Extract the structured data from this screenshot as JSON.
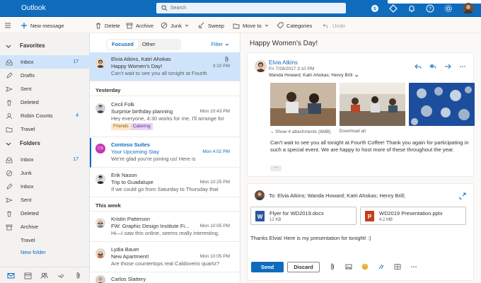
{
  "app": {
    "title": "Outlook"
  },
  "search": {
    "placeholder": "Search"
  },
  "commands": {
    "new_message": "New message",
    "delete": "Delete",
    "archive": "Archive",
    "junk": "Junk",
    "sweep": "Sweep",
    "move_to": "Move to",
    "categories": "Categories",
    "undo": "Undo"
  },
  "sidebar": {
    "favorites_label": "Favorites",
    "favorites": [
      {
        "label": "Inbox",
        "count": "17",
        "icon": "inbox-icon"
      },
      {
        "label": "Drafts",
        "count": "",
        "icon": "pencil-icon"
      },
      {
        "label": "Sent",
        "count": "",
        "icon": "send-icon"
      },
      {
        "label": "Deleted",
        "count": "",
        "icon": "trash-icon"
      },
      {
        "label": "Robin Counts",
        "count": "4",
        "icon": "person-icon"
      },
      {
        "label": "Travel",
        "count": "",
        "icon": "folder-icon"
      }
    ],
    "folders_label": "Folders",
    "folders": [
      {
        "label": "Inbox",
        "count": "17"
      },
      {
        "label": "Junk",
        "count": ""
      },
      {
        "label": "Inbox",
        "count": ""
      },
      {
        "label": "Sent",
        "count": ""
      },
      {
        "label": "Deleted",
        "count": ""
      },
      {
        "label": "Archive",
        "count": ""
      },
      {
        "label": "Travel",
        "count": ""
      }
    ],
    "new_folder": "New folder"
  },
  "list": {
    "pivots": [
      "Focused",
      "Other"
    ],
    "filter": "Filter",
    "sections": {
      "yesterday": "Yesterday",
      "this_week": "This week"
    },
    "messages": [
      {
        "sender": "Elvia Atkins, Katri Ahokas",
        "subject": "Happy Women's Day!",
        "time": "3:10 PM",
        "preview": "Can't wait to see you all tonight at Fourth"
      },
      {
        "sender": "Cecil Folk",
        "subject": "Surprise birthday planning",
        "time": "Mon 10:43 PM",
        "preview": "Hey everyone, 4:30 works for me, I'll arrange for",
        "categories": [
          "Friends",
          "Catering"
        ]
      },
      {
        "sender": "Contoso Suites",
        "subject": "Your Upcoming Stay",
        "time": "Mon 4:02 PM",
        "preview": "We're glad you're joining us! Here is",
        "initials": "CS"
      },
      {
        "sender": "Erik Nason",
        "subject": "Trip to Guadalupe",
        "time": "Mon 10:25 PM",
        "preview": "If we could go from Saturday to Thursday that"
      },
      {
        "sender": "Kristin Patterson",
        "subject": "FW: Graphic Design Institute Fi...",
        "time": "Mon 10:05 PM",
        "preview": "Hi—I saw this online, seems really interesting."
      },
      {
        "sender": "Lydia Bauer",
        "subject": "New Apartment!",
        "time": "Mon 10:05 PM",
        "preview": "Are those countertops real Caldoveiro quartz?"
      },
      {
        "sender": "Carlos Slattery",
        "subject": "",
        "time": "",
        "preview": ""
      }
    ]
  },
  "reading": {
    "title": "Happy Women's Day!",
    "sender": "Elvia Atkins",
    "date": "Fri 7/28/2017 3:10 PM",
    "to": "Wanda Howard; Katri Ahokas; Henry Brill",
    "attachments_label": "Show 4 attachments (6MB)",
    "download_all": "Download all",
    "body": "Can't wait to see you all tonight at Fourth Coffee! Thank you again for participating in such a special event. We are happy to host more of these throughout the year.",
    "reply_to": "To: Elvia Atkins; Wanda Howard; Katri Ahokas; Henry Brill;",
    "files": [
      {
        "name": "Flyer for WD2019.docx",
        "size": "12 KB"
      },
      {
        "name": "WD2019 Presentation.pptx",
        "size": "4.2 MB"
      }
    ],
    "reply_body": "Thanks Elvia! Here is my presentation for tonight! :)",
    "send": "Send",
    "discard": "Discard"
  },
  "colors": {
    "accent": "#0f6cbd",
    "word": "#2b579a",
    "powerpoint": "#c43e1c"
  }
}
